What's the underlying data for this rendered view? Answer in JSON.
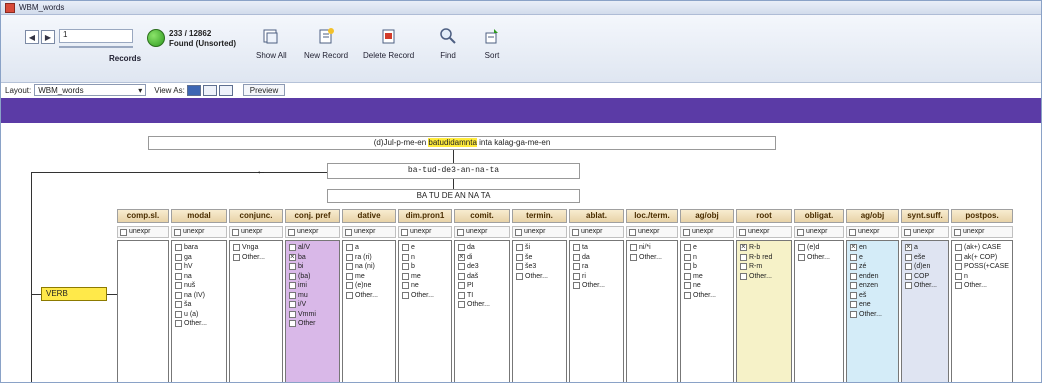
{
  "window": {
    "title": "WBM_words"
  },
  "toolbar": {
    "record_number": "1",
    "records_label": "Records",
    "found_count": "233 / 12862",
    "found_state": "Found (Unsorted)",
    "buttons": [
      {
        "label": "Show All",
        "icon": "show-all-icon"
      },
      {
        "label": "New Record",
        "icon": "new-record-icon"
      },
      {
        "label": "Delete Record",
        "icon": "delete-record-icon"
      },
      {
        "label": "Find",
        "icon": "find-icon"
      },
      {
        "label": "Sort",
        "icon": "sort-icon"
      }
    ]
  },
  "layoutbar": {
    "layout_label": "Layout:",
    "layout_value": "WBM_words",
    "view_label": "View As:",
    "preview_label": "Preview"
  },
  "record": {
    "sentence_before": "(d)Jul-p-me-en ",
    "sentence_highlight": "batudidamnta",
    "sentence_after": " inta kalag-ga-me-en",
    "segmentation": "ba-tud-de3-an-na-ta",
    "gloss": "BA TU DE AN NA TA",
    "category": "VERB"
  },
  "colors": {
    "purple_band": "#5b3ba6",
    "verb_box": "#ffe94a",
    "conj_pref_col": "#d9b8e8",
    "root_col": "#f6f2c8",
    "ag_obj_col": "#d4ecf8",
    "synt_suff_col": "#dfe4f2"
  },
  "columns": [
    {
      "header": "comp.sl.",
      "unexpr": "unexpr",
      "options": []
    },
    {
      "header": "modal",
      "unexpr": "unexpr",
      "options": [
        {
          "text": "bara",
          "checked": false
        },
        {
          "text": "ga",
          "checked": false
        },
        {
          "text": "hV",
          "checked": false
        },
        {
          "text": "na",
          "checked": false
        },
        {
          "text": "nuš",
          "checked": false
        },
        {
          "text": "na (IV)",
          "checked": false
        },
        {
          "text": "ša",
          "checked": false
        },
        {
          "text": "u (a)",
          "checked": false
        },
        {
          "text": "Other...",
          "checked": false
        }
      ]
    },
    {
      "header": "conjunc.",
      "unexpr": "unexpr",
      "options": [
        {
          "text": "Vnga",
          "checked": false
        },
        {
          "text": "Other...",
          "checked": false
        }
      ]
    },
    {
      "header": "conj. pref",
      "unexpr": "unexpr",
      "options": [
        {
          "text": "al/V",
          "checked": false
        },
        {
          "text": "ba",
          "checked": true
        },
        {
          "text": "bi",
          "checked": false
        },
        {
          "text": "(ba)",
          "checked": false
        },
        {
          "text": "imi",
          "checked": false
        },
        {
          "text": "mu",
          "checked": false
        },
        {
          "text": "i/V",
          "checked": false
        },
        {
          "text": "Vmmi",
          "checked": false
        },
        {
          "text": "Other",
          "checked": false
        }
      ]
    },
    {
      "header": "dative",
      "unexpr": "unexpr",
      "options": [
        {
          "text": "a",
          "checked": false
        },
        {
          "text": "ra (ri)",
          "checked": false
        },
        {
          "text": "na (ni)",
          "checked": false
        },
        {
          "text": "me",
          "checked": false
        },
        {
          "text": "(e)ne",
          "checked": false
        },
        {
          "text": "Other...",
          "checked": false
        }
      ]
    },
    {
      "header": "dim.pron1",
      "unexpr": "unexpr",
      "options": [
        {
          "text": "e",
          "checked": false
        },
        {
          "text": "n",
          "checked": false
        },
        {
          "text": "b",
          "checked": false
        },
        {
          "text": "me",
          "checked": false
        },
        {
          "text": "ne",
          "checked": false
        },
        {
          "text": "Other...",
          "checked": false
        }
      ]
    },
    {
      "header": "comit.",
      "unexpr": "unexpr",
      "options": [
        {
          "text": "da",
          "checked": false
        },
        {
          "text": "di",
          "checked": true
        },
        {
          "text": "de3",
          "checked": false
        },
        {
          "text": "daš",
          "checked": false
        },
        {
          "text": "PI",
          "checked": false
        },
        {
          "text": "TI",
          "checked": false
        },
        {
          "text": "Other...",
          "checked": false
        }
      ]
    },
    {
      "header": "termin.",
      "unexpr": "unexpr",
      "options": [
        {
          "text": "ši",
          "checked": false
        },
        {
          "text": "še",
          "checked": false
        },
        {
          "text": "še3",
          "checked": false
        },
        {
          "text": "Other...",
          "checked": false
        }
      ]
    },
    {
      "header": "ablat.",
      "unexpr": "unexpr",
      "options": [
        {
          "text": "ta",
          "checked": false
        },
        {
          "text": "da",
          "checked": false
        },
        {
          "text": "ra",
          "checked": false
        },
        {
          "text": "ri",
          "checked": false
        },
        {
          "text": "Other...",
          "checked": false
        }
      ]
    },
    {
      "header": "loc./term.",
      "unexpr": "unexpr",
      "options": [
        {
          "text": "ni/*i",
          "checked": false
        },
        {
          "text": "Other...",
          "checked": false
        }
      ]
    },
    {
      "header": "ag/obj",
      "unexpr": "unexpr",
      "options": [
        {
          "text": "e",
          "checked": false
        },
        {
          "text": "n",
          "checked": false
        },
        {
          "text": "b",
          "checked": false
        },
        {
          "text": "me",
          "checked": false
        },
        {
          "text": "ne",
          "checked": false
        },
        {
          "text": "Other...",
          "checked": false
        }
      ]
    },
    {
      "header": "root",
      "unexpr": "unexpr",
      "options": [
        {
          "text": "R-b",
          "checked": true
        },
        {
          "text": "R-b red",
          "checked": false
        },
        {
          "text": "R-m",
          "checked": false
        },
        {
          "text": "Other...",
          "checked": false
        }
      ]
    },
    {
      "header": "obligat.",
      "unexpr": "unexpr",
      "options": [
        {
          "text": "(e)d",
          "checked": false
        },
        {
          "text": "Other...",
          "checked": false
        }
      ]
    },
    {
      "header": "ag/obj",
      "unexpr": "unexpr",
      "options": [
        {
          "text": "en",
          "checked": true
        },
        {
          "text": "e",
          "checked": false
        },
        {
          "text": "zé",
          "checked": false
        },
        {
          "text": "enden",
          "checked": false
        },
        {
          "text": "enzen",
          "checked": false
        },
        {
          "text": "eš",
          "checked": false
        },
        {
          "text": "ene",
          "checked": false
        },
        {
          "text": "Other...",
          "checked": false
        }
      ]
    },
    {
      "header": "synt.suff.",
      "unexpr": "unexpr",
      "options": [
        {
          "text": "a",
          "checked": true
        },
        {
          "text": "eše",
          "checked": false
        },
        {
          "text": "(d)en",
          "checked": false
        },
        {
          "text": "COP",
          "checked": false
        },
        {
          "text": "Other...",
          "checked": false
        }
      ]
    },
    {
      "header": "postpos.",
      "unexpr": "unexpr",
      "options": [
        {
          "text": "(ak+) CASE",
          "checked": false
        },
        {
          "text": "ak(+ COP)",
          "checked": false
        },
        {
          "text": "POSS(+CASE)",
          "checked": false
        },
        {
          "text": "n",
          "checked": false
        },
        {
          "text": "Other...",
          "checked": false
        }
      ]
    }
  ]
}
